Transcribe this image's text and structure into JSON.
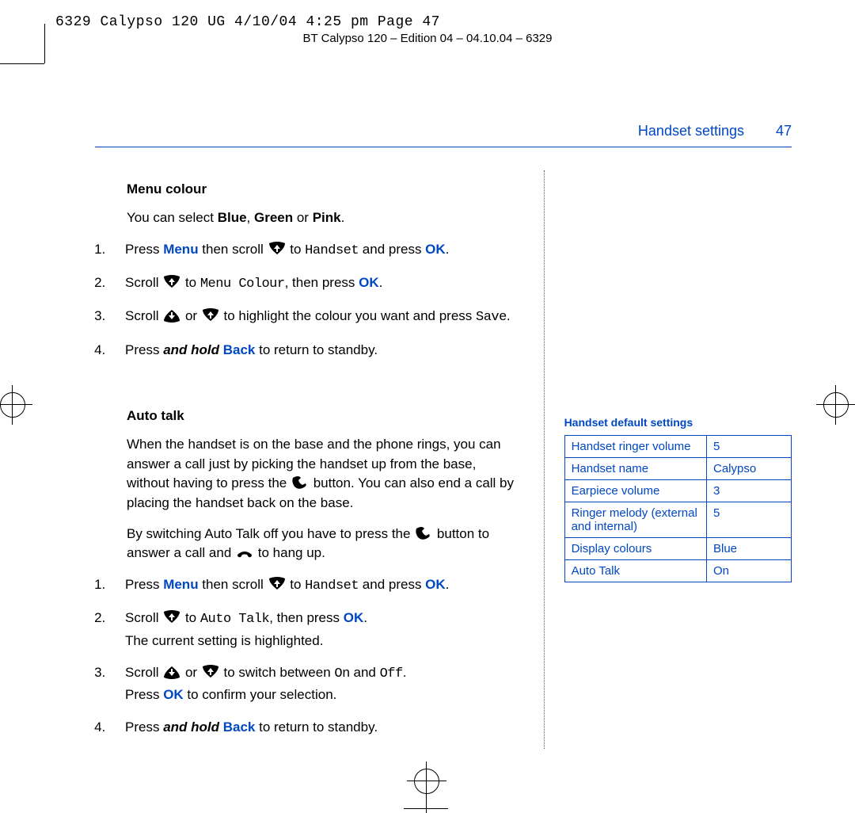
{
  "header": {
    "crop_line": "6329 Calypso 120 UG   4/10/04  4:25 pm  Page 47",
    "edition_line": "BT Calypso 120 – Edition 04 – 04.10.04 – 6329"
  },
  "running_head": "Handset settings",
  "page_number": "47",
  "sections": {
    "menu_colour": {
      "title": "Menu colour",
      "intro_pre": "You can select ",
      "opt1": "Blue",
      "sep1": ", ",
      "opt2": "Green",
      "sep2": " or ",
      "opt3": "Pink",
      "intro_post": ".",
      "step1_a": "Press ",
      "step1_menu": "Menu",
      "step1_b": " then scroll ",
      "step1_c": " to ",
      "step1_lcd": "Handset",
      "step1_d": " and press ",
      "step1_ok": "OK",
      "step1_e": ".",
      "step2_a": "Scroll ",
      "step2_b": " to ",
      "step2_lcd": "Menu Colour",
      "step2_c": ", then press ",
      "step2_ok": "OK",
      "step2_d": ".",
      "step3_a": "Scroll ",
      "step3_b": " or ",
      "step3_c": " to highlight the colour you want and press ",
      "step3_lcd": "Save",
      "step3_d": ".",
      "step4_a": "Press ",
      "step4_bi": "and hold",
      "step4_b": " ",
      "step4_back": "Back",
      "step4_c": " to return to standby."
    },
    "auto_talk": {
      "title": "Auto talk",
      "para1_a": "When the handset is on the base and the phone rings, you can answer a call just by picking the handset up from the base, without having to press the ",
      "para1_b": " button. You can also end a call by placing the handset back on the base.",
      "para2_a": "By switching Auto Talk off you have to press the ",
      "para2_b": " button to answer a call and ",
      "para2_c": " to hang up.",
      "step1_a": "Press ",
      "step1_menu": "Menu",
      "step1_b": " then scroll ",
      "step1_c": " to ",
      "step1_lcd": "Handset",
      "step1_d": " and press ",
      "step1_ok": "OK",
      "step1_e": ".",
      "step2_a": "Scroll ",
      "step2_b": " to ",
      "step2_lcd": "Auto Talk",
      "step2_c": ", then press ",
      "step2_ok": "OK",
      "step2_d": ".",
      "step2_line2": "The current setting is highlighted.",
      "step3_a": "Scroll ",
      "step3_b": " or ",
      "step3_c": " to switch between ",
      "step3_on": "On",
      "step3_d": " and ",
      "step3_off": "Off",
      "step3_e": ".",
      "step3_line2_a": "Press ",
      "step3_line2_ok": "OK",
      "step3_line2_b": " to confirm your selection.",
      "step4_a": "Press ",
      "step4_bi": "and hold",
      "step4_b": " ",
      "step4_back": "Back",
      "step4_c": " to return to standby."
    }
  },
  "sidebar": {
    "title": "Handset default settings",
    "rows": [
      {
        "label": "Handset ringer volume",
        "value": "5"
      },
      {
        "label": "Handset name",
        "value": "Calypso"
      },
      {
        "label": "Earpiece volume",
        "value": "3"
      },
      {
        "label": "Ringer melody (external and internal)",
        "value": "5"
      },
      {
        "label": "Display colours",
        "value": "Blue"
      },
      {
        "label": "Auto Talk",
        "value": "On"
      }
    ]
  }
}
